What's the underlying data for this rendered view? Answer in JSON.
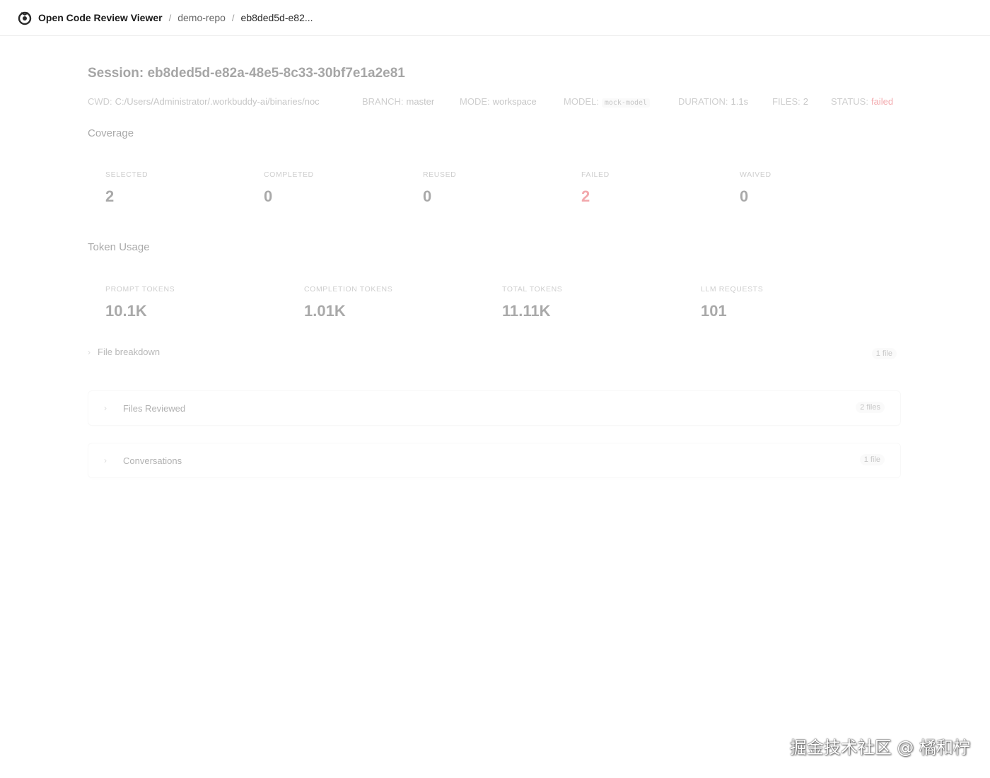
{
  "header": {
    "app_name": "Open Code Review Viewer",
    "separator": "/",
    "repo": "demo-repo",
    "session_short": "eb8ded5d-e82..."
  },
  "session": {
    "title": "Session: eb8ded5d-e82a-48e5-8c33-30bf7e1a2e81",
    "meta": {
      "cwd_label": "CWD:",
      "cwd_value": "C:/Users/Administrator/.workbuddy-ai/binaries/noc",
      "branch_label": "BRANCH:",
      "branch_value": "master",
      "mode_label": "MODE:",
      "mode_value": "workspace",
      "model_label": "MODEL:",
      "model_value": "mock-model",
      "duration_label": "DURATION:",
      "duration_value": "1.1s",
      "files_label": "FILES:",
      "files_value": "2",
      "status_label": "STATUS:",
      "status_value": "failed"
    }
  },
  "coverage": {
    "title": "Coverage",
    "stats": [
      {
        "label": "SELECTED",
        "value": "2"
      },
      {
        "label": "COMPLETED",
        "value": "0"
      },
      {
        "label": "REUSED",
        "value": "0"
      },
      {
        "label": "FAILED",
        "value": "2"
      },
      {
        "label": "WAIVED",
        "value": "0"
      }
    ]
  },
  "token_usage": {
    "title": "Token Usage",
    "stats": [
      {
        "label": "PROMPT TOKENS",
        "value": "10.1K"
      },
      {
        "label": "COMPLETION TOKENS",
        "value": "1.01K"
      },
      {
        "label": "TOTAL TOKENS",
        "value": "11.11K"
      },
      {
        "label": "LLM REQUESTS",
        "value": "101"
      }
    ]
  },
  "file_breakdown": {
    "label": "File breakdown",
    "count": "1 file"
  },
  "files_reviewed": {
    "label": "Files Reviewed",
    "count": "2 files"
  },
  "conversations": {
    "label": "Conversations",
    "count": "1 file"
  },
  "watermark": "掘金技术社区 @ 橘和柠",
  "colors": {
    "failed": "#e0303a",
    "border": "#ececec"
  },
  "icons": {
    "logo": "app-logo-icon",
    "chevron": "chevron-right-icon"
  }
}
